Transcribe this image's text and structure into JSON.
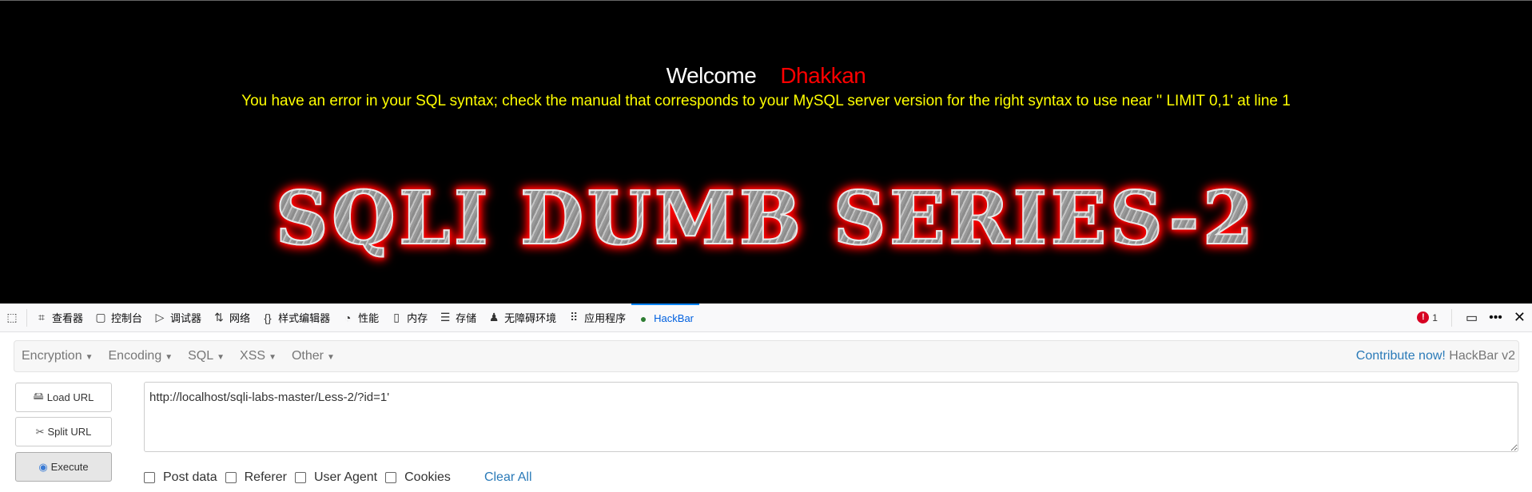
{
  "page": {
    "welcome": "Welcome",
    "user": "Dhakkan",
    "error": "You have an error in your SQL syntax; check the manual that corresponds to your MySQL server version for the right syntax to use near '' LIMIT 0,1' at line 1",
    "title": "SQLI DUMB SERIES-2"
  },
  "devtools": {
    "tabs": [
      {
        "label": "查看器",
        "icon": "inspector-icon"
      },
      {
        "label": "控制台",
        "icon": "console-icon"
      },
      {
        "label": "调试器",
        "icon": "debugger-icon"
      },
      {
        "label": "网络",
        "icon": "network-icon"
      },
      {
        "label": "样式编辑器",
        "icon": "style-editor-icon"
      },
      {
        "label": "性能",
        "icon": "performance-icon"
      },
      {
        "label": "内存",
        "icon": "memory-icon"
      },
      {
        "label": "存储",
        "icon": "storage-icon"
      },
      {
        "label": "无障碍环境",
        "icon": "accessibility-icon"
      },
      {
        "label": "应用程序",
        "icon": "application-icon"
      },
      {
        "label": "HackBar",
        "icon": "hackbar-icon",
        "active": true
      }
    ],
    "error_count": "1",
    "accent": "#0a84ff"
  },
  "hackbar": {
    "menu": [
      "Encryption",
      "Encoding",
      "SQL",
      "XSS",
      "Other"
    ],
    "contribute": "Contribute now!",
    "version": "HackBar v2",
    "buttons": {
      "load": "Load URL",
      "split": "Split URL",
      "execute": "Execute"
    },
    "url": "http://localhost/sqli-labs-master/Less-2/?id=1'",
    "options": [
      "Post data",
      "Referer",
      "User Agent",
      "Cookies"
    ],
    "clear_all": "Clear All"
  }
}
